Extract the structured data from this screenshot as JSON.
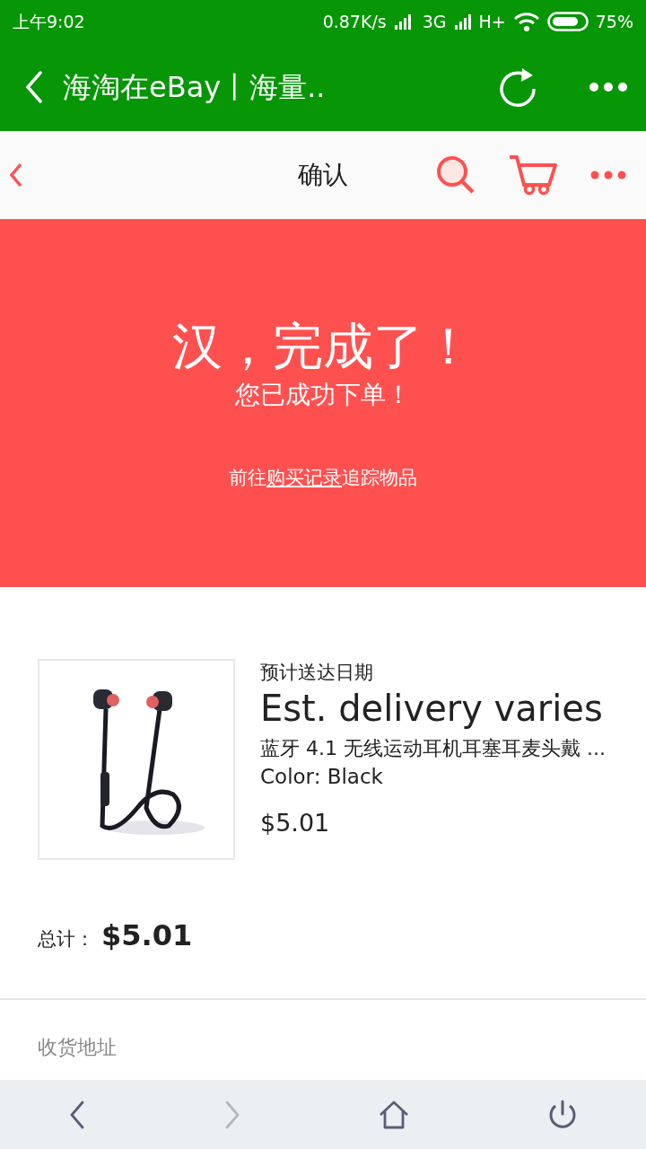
{
  "status_bar": {
    "time": "上午9:02",
    "speed": "0.87K/s",
    "network": "3G",
    "network_2": "H+",
    "battery": "75%"
  },
  "browser_bar": {
    "title": "海淘在eBay丨海量.."
  },
  "page_header": {
    "title": "确认"
  },
  "hero": {
    "heading": "汉，完成了！",
    "subtitle": "您已成功下单！",
    "note_before": "前往",
    "note_link": "购买记录",
    "note_after": "追踪物品"
  },
  "order": {
    "delivery_label": "预计送达日期",
    "delivery": "Est. delivery varies",
    "item_title": "蓝牙 4.1 无线运动耳机耳塞耳麦头戴 ...",
    "item_color": "Color: Black",
    "item_price": "$5.01",
    "total_label": "总计：",
    "total": "$5.01"
  },
  "shipping": {
    "label": "收货地址"
  },
  "bottom_nav": [
    {
      "kind": "back",
      "disabled": false
    },
    {
      "kind": "forward",
      "disabled": true
    },
    {
      "kind": "home",
      "disabled": false
    },
    {
      "kind": "power",
      "disabled": false
    }
  ]
}
